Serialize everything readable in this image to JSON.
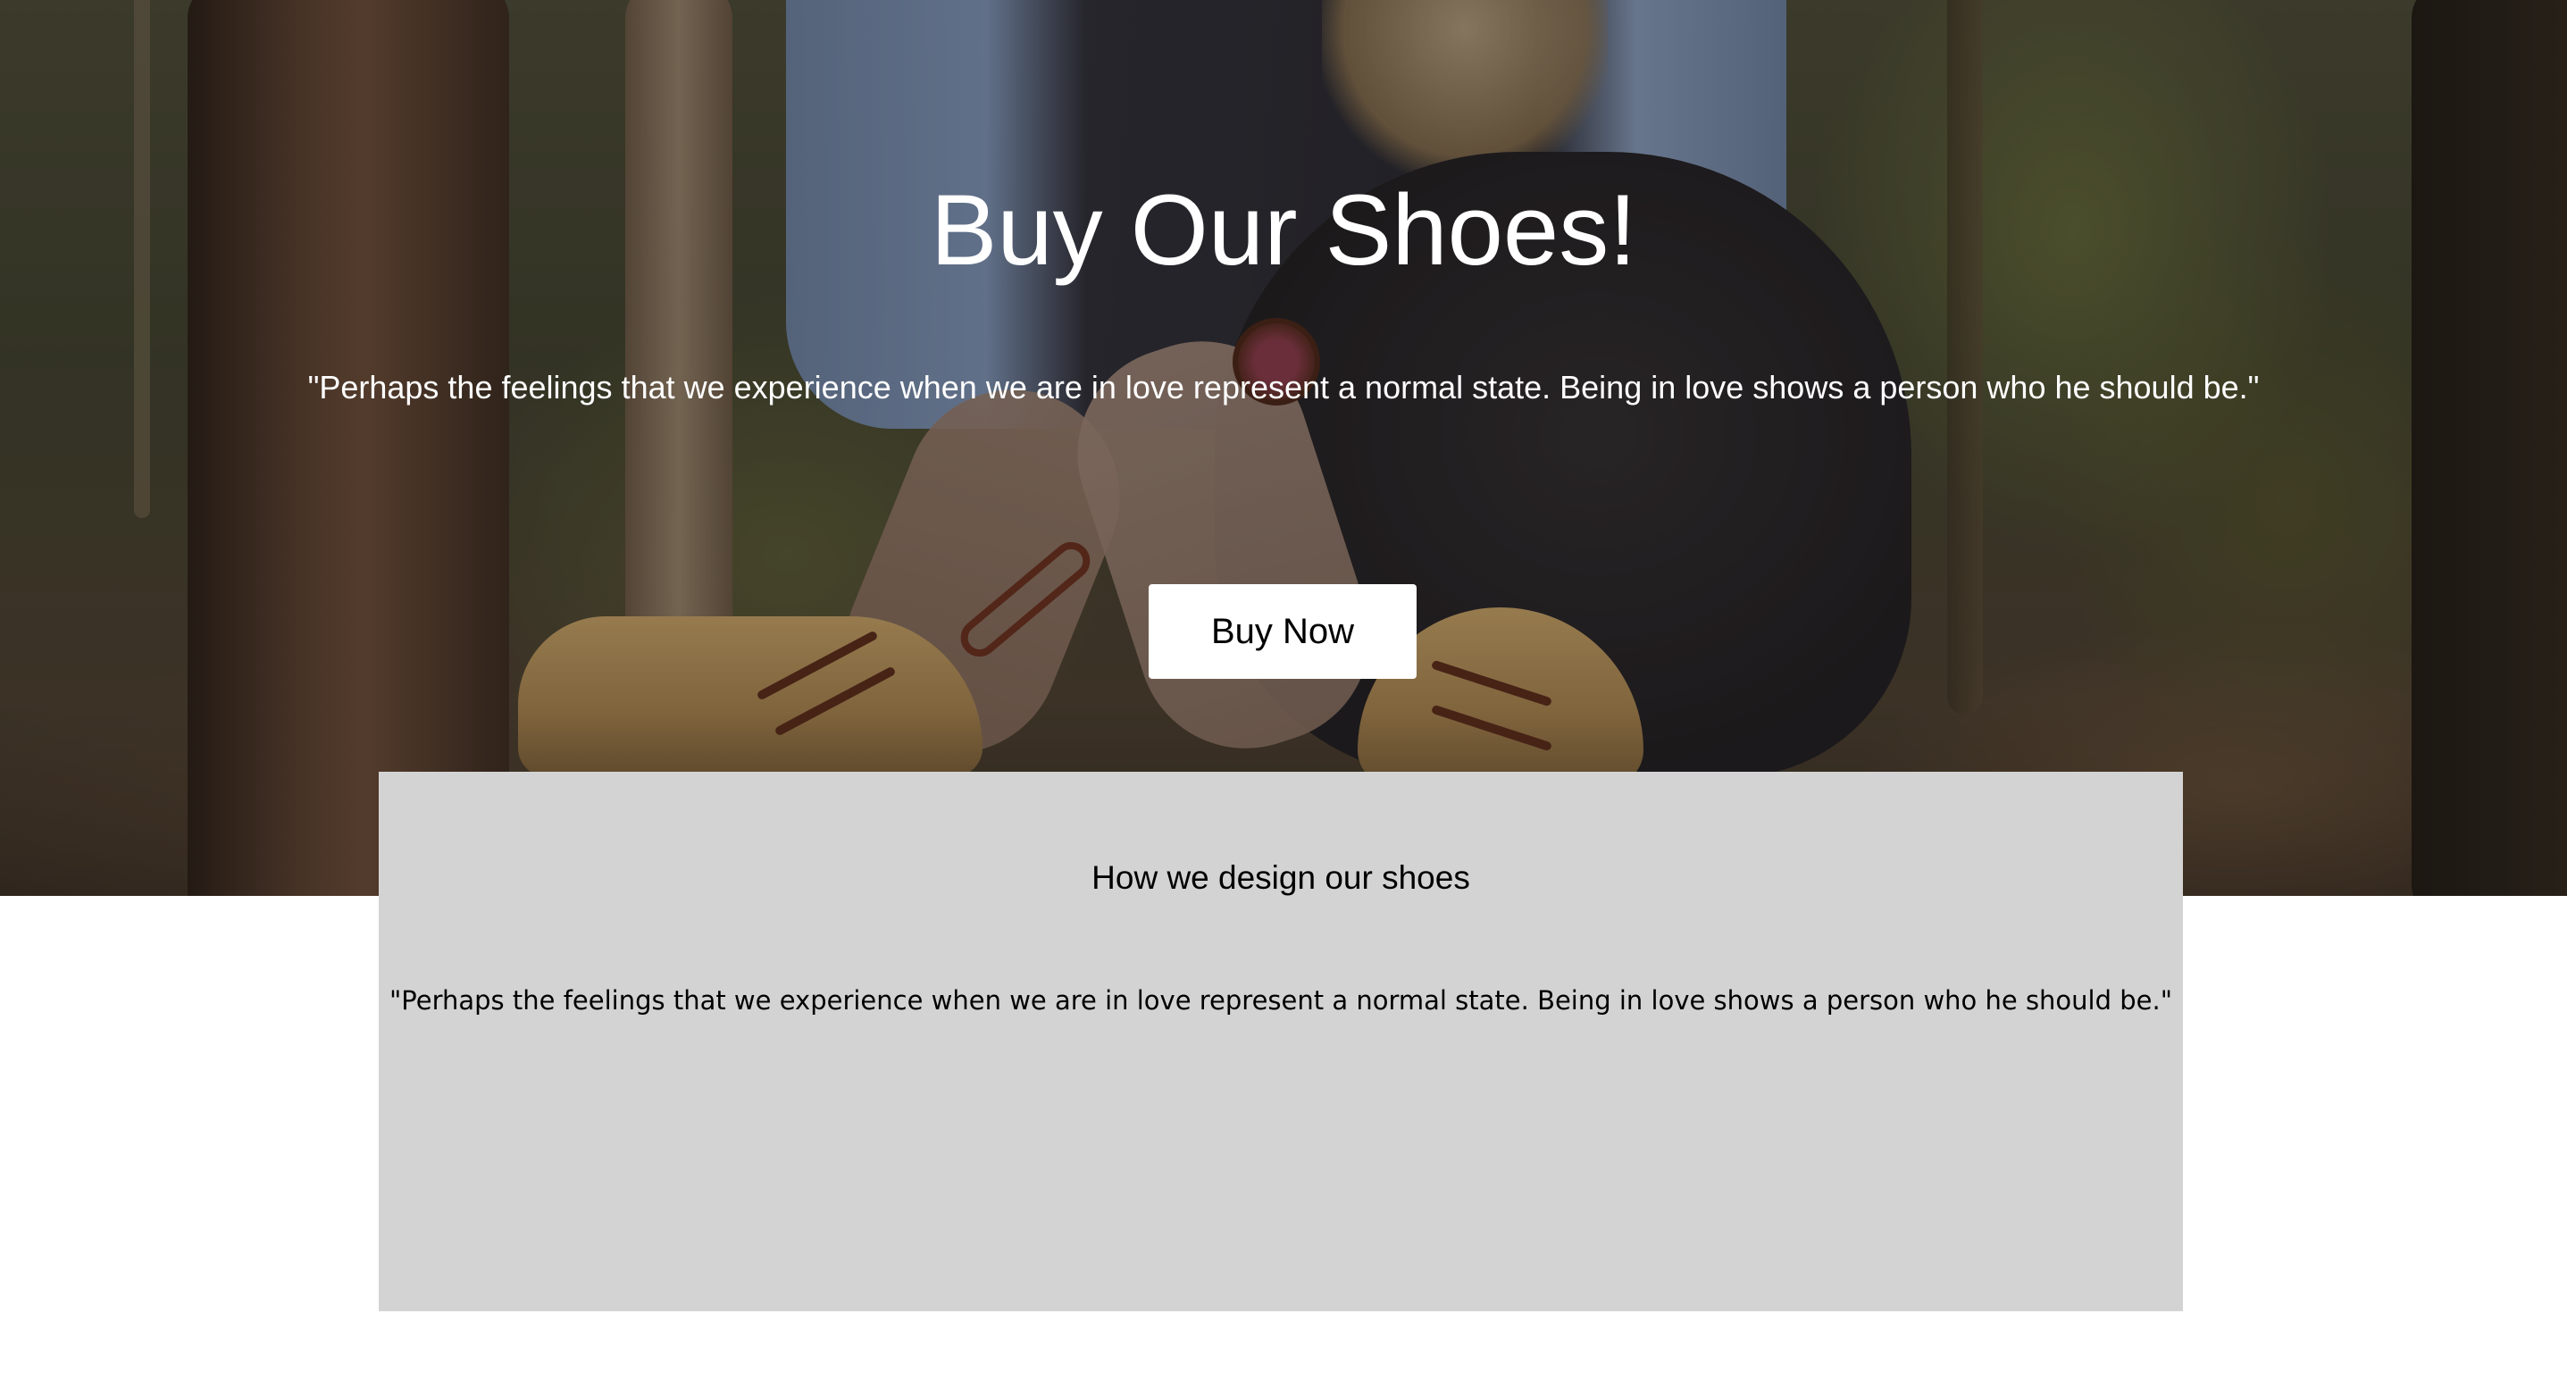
{
  "hero": {
    "title": "Buy Our Shoes!",
    "quote": "\"Perhaps the feelings that we experience when we are in love represent a normal state. Being in love shows a person who he should be.\"",
    "button_label": "Buy Now",
    "text_color": "#ffffff",
    "button_background": "#ffffff",
    "background_image": "forest-person-boots-photo"
  },
  "design_section": {
    "heading": "How we design our shoes",
    "quote": "\"Perhaps the feelings that we experience when we are in love represent a normal state. Being in love shows a person who he should be.\"",
    "background_color": "#d3d3d3"
  },
  "page": {
    "background_color": "#ffffff"
  }
}
